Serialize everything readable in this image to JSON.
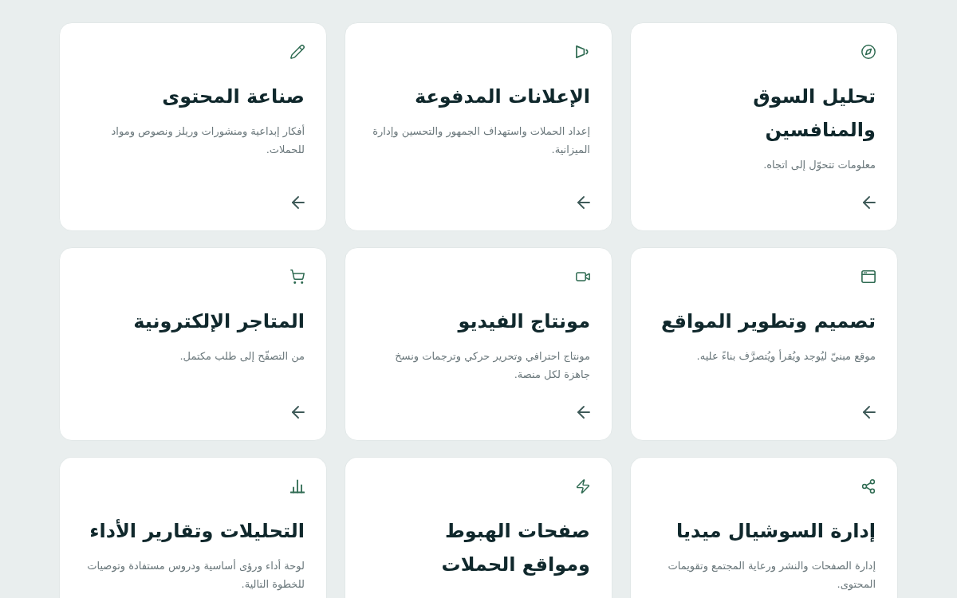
{
  "cards": [
    {
      "title": "تحليل السوق والمنافسين",
      "description": "معلومات تتحوّل إلى اتجاه.",
      "arrow": true
    },
    {
      "title": "الإعلانات المدفوعة",
      "description": "إعداد الحملات واستهداف الجمهور والتحسين وإدارة الميزانية.",
      "arrow": true
    },
    {
      "title": "صناعة المحتوى",
      "description": "أفكار إبداعية ومنشورات وريلز ونصوص ومواد للحملات.",
      "arrow": true
    },
    {
      "title": "تصميم وتطوير المواقع",
      "description": "موقع مبنيّ ليُوجد ويُقرأ ويُتصرَّف بناءً عليه.",
      "arrow": true
    },
    {
      "title": "مونتاج الفيديو",
      "description": "مونتاج احترافي وتحرير حركي وترجمات ونسخ جاهزة لكل منصة.",
      "arrow": true
    },
    {
      "title": "المتاجر الإلكترونية",
      "description": "من التصفّح إلى طلب مكتمل.",
      "arrow": true
    },
    {
      "title": "إدارة السوشيال ميديا",
      "description": "إدارة الصفحات والنشر ورعاية المجتمع وتقويمات المحتوى."
    },
    {
      "title": "صفحات الهبوط ومواقع الحملات"
    },
    {
      "title": "التحليلات وتقارير الأداء",
      "description": "لوحة أداء ورؤى أساسية ودروس مستفادة وتوصيات للخطوة التالية."
    }
  ]
}
